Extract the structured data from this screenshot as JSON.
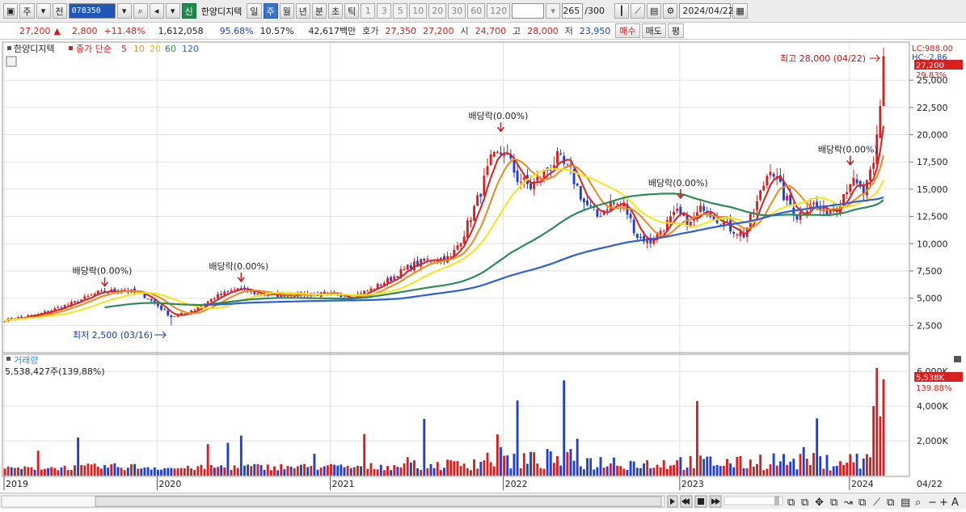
{
  "toolbar": {
    "market_btn": "주",
    "prev_btn": "전",
    "code": "078350",
    "shin_badge": "신",
    "stock_name": "한양디지텍",
    "period_buttons": [
      "일",
      "주",
      "월",
      "년",
      "분",
      "초",
      "틱"
    ],
    "active_period": "주",
    "interval_buttons": [
      "1",
      "3",
      "5",
      "10",
      "20",
      "30",
      "60",
      "120"
    ],
    "count": "265",
    "count_total": "/300",
    "date": "2024/04/22"
  },
  "info": {
    "price": "27,200",
    "change": "2,800",
    "change_pct": "+11.48%",
    "volume": "1,612,058",
    "vol_ratio": "95.68%",
    "turnover": "10.57%",
    "amount": "42,617백만",
    "quote_label": "호가",
    "ask": "27,350",
    "bid": "27,200",
    "open_label": "시",
    "open": "24,700",
    "high_label": "고",
    "high": "28,000",
    "low_label": "저",
    "low": "23,950",
    "buy_label": "매수",
    "sell_label": "매도",
    "eval_label": "평"
  },
  "price_panel": {
    "legend_name": "한양디지텍",
    "legend_close": "종가 단순",
    "ma_labels": [
      "5",
      "10",
      "20",
      "60",
      "120"
    ],
    "ma_colors": [
      "#e02020",
      "#ee8a18",
      "#f4e61a",
      "#2e8b57",
      "#2f5ed6"
    ],
    "lc_label": "LC:988.00",
    "hc_label": "HC:-2.86",
    "current_price_tag": "27,200",
    "current_pct_tag": "29.83%",
    "y_ticks": [
      "25,000",
      "22,500",
      "20,000",
      "17,500",
      "15,000",
      "12,500",
      "10,000",
      "7,500",
      "5,000",
      "2,500"
    ],
    "high_annotation": "최고 28,000 (04/22)",
    "low_annotation": "최저 2,500 (03/16)",
    "dividend_label": "배당락(0.00%)"
  },
  "volume_panel": {
    "title": "거래량",
    "value_text": "5,538,427주(139,88%)",
    "current_tag": "5,538K",
    "current_pct": "139.88%",
    "y_ticks": [
      "6,000K",
      "4,000K",
      "2,000K"
    ]
  },
  "x_axis": {
    "labels": [
      "2019",
      "2020",
      "2021",
      "2022",
      "2023",
      "2024"
    ],
    "last_date": "04/22"
  },
  "chart_data": {
    "type": "candlestick",
    "timeframe": "weekly",
    "ylim": [
      0,
      28500
    ],
    "volume_ylim": [
      0,
      6800000
    ],
    "close_keypoints": [
      [
        0,
        3000
      ],
      [
        10,
        3500
      ],
      [
        20,
        4500
      ],
      [
        28,
        5500
      ],
      [
        36,
        5800
      ],
      [
        42,
        5200
      ],
      [
        46,
        4300
      ],
      [
        50,
        3300
      ],
      [
        54,
        3600
      ],
      [
        58,
        4200
      ],
      [
        64,
        5200
      ],
      [
        70,
        5900
      ],
      [
        76,
        5400
      ],
      [
        82,
        5300
      ],
      [
        90,
        5400
      ],
      [
        98,
        5300
      ],
      [
        104,
        5100
      ],
      [
        110,
        5800
      ],
      [
        116,
        6800
      ],
      [
        122,
        8000
      ],
      [
        128,
        8600
      ],
      [
        134,
        8700
      ],
      [
        138,
        11000
      ],
      [
        142,
        14000
      ],
      [
        146,
        17500
      ],
      [
        150,
        18600
      ],
      [
        154,
        16000
      ],
      [
        158,
        15200
      ],
      [
        162,
        16500
      ],
      [
        166,
        17800
      ],
      [
        170,
        16500
      ],
      [
        174,
        13800
      ],
      [
        178,
        12500
      ],
      [
        182,
        13700
      ],
      [
        186,
        13500
      ],
      [
        190,
        10700
      ],
      [
        194,
        10200
      ],
      [
        198,
        11600
      ],
      [
        202,
        12800
      ],
      [
        206,
        11800
      ],
      [
        210,
        13500
      ],
      [
        214,
        12300
      ],
      [
        218,
        11400
      ],
      [
        222,
        10800
      ],
      [
        226,
        13700
      ],
      [
        230,
        17200
      ],
      [
        234,
        14400
      ],
      [
        238,
        12500
      ],
      [
        242,
        13800
      ],
      [
        246,
        12900
      ],
      [
        250,
        13500
      ],
      [
        254,
        15800
      ],
      [
        258,
        14600
      ],
      [
        261,
        17000
      ],
      [
        263,
        22500
      ],
      [
        264,
        27200
      ]
    ],
    "ma_periods": [
      5,
      10,
      20,
      60,
      120
    ],
    "dividend_points": [
      30,
      71,
      149,
      203,
      254
    ],
    "high": {
      "value": 28000,
      "date": "04/22"
    },
    "low": {
      "value": 2500,
      "date": "03/16"
    }
  }
}
